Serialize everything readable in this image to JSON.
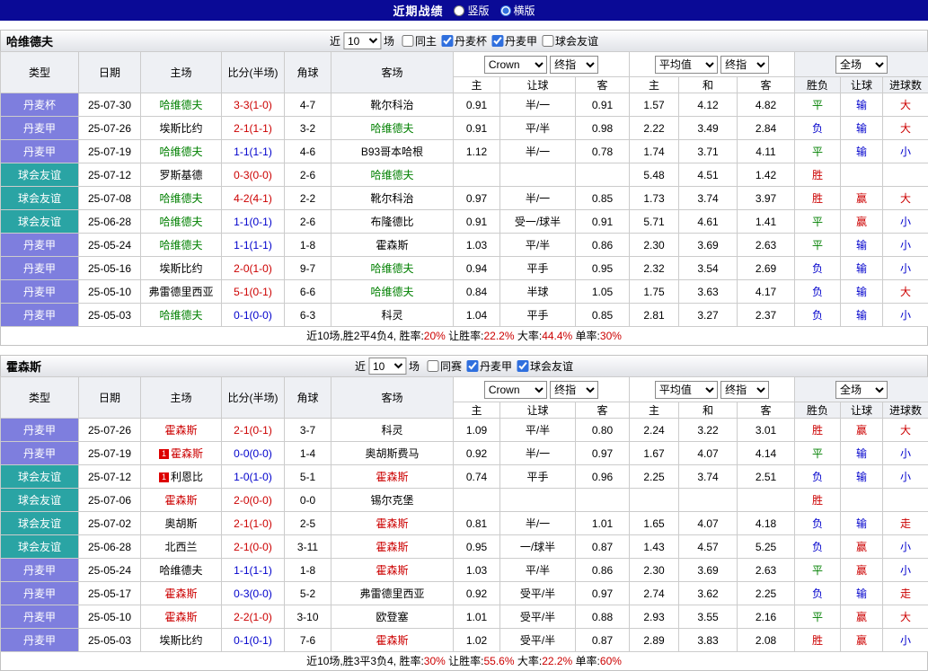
{
  "titlebar": {
    "title": "近期战绩",
    "radios": [
      {
        "label": "竖版",
        "selected": false
      },
      {
        "label": "横版",
        "selected": true
      }
    ]
  },
  "colors": {
    "r": "#cc0000",
    "b": "#0000cc",
    "g": "#008000",
    "k": "#000000",
    "p": "#7e7ede",
    "t": "#2aa4a4"
  },
  "filter_labels": {
    "near": "近",
    "games": "场"
  },
  "dropdowns": {
    "company": "Crown",
    "company_mode": "终指",
    "average": "平均值",
    "average_mode": "终指",
    "scope": "全场"
  },
  "columns": {
    "type": "类型",
    "date": "日期",
    "home": "主场",
    "score": "比分(半场)",
    "corners": "角球",
    "away": "客场",
    "sub": [
      "主",
      "让球",
      "客",
      "主",
      "和",
      "客",
      "胜负",
      "让球",
      "进球数"
    ]
  },
  "sections": [
    {
      "team": "哈维德夫",
      "subject_color": "#008000",
      "filter": {
        "count": "10",
        "checkboxes": [
          {
            "label": "同主",
            "checked": false
          },
          {
            "label": "丹麦杯",
            "checked": true
          },
          {
            "label": "丹麦甲",
            "checked": true
          },
          {
            "label": "球会友谊",
            "checked": false
          }
        ]
      },
      "rows": [
        {
          "type": "丹麦杯",
          "tc": "p",
          "date": "25-07-30",
          "home": "哈维德夫",
          "hs": true,
          "hb": "",
          "score": "3-3(1-0)",
          "sc": "r",
          "corners": "4-7",
          "away": "靴尔科治",
          "as": false,
          "ab": "",
          "odds": [
            "0.91",
            "半/一",
            "0.91"
          ],
          "avg": [
            "1.57",
            "4.12",
            "4.82"
          ],
          "res": "平",
          "resc": "g",
          "hc": "输",
          "hcc": "b",
          "goal": "大",
          "gc": "r"
        },
        {
          "type": "丹麦甲",
          "tc": "p",
          "date": "25-07-26",
          "home": "埃斯比约",
          "hs": false,
          "hb": "",
          "score": "2-1(1-1)",
          "sc": "r",
          "corners": "3-2",
          "away": "哈维德夫",
          "as": true,
          "ab": "",
          "odds": [
            "0.91",
            "平/半",
            "0.98"
          ],
          "avg": [
            "2.22",
            "3.49",
            "2.84"
          ],
          "res": "负",
          "resc": "b",
          "hc": "输",
          "hcc": "b",
          "goal": "大",
          "gc": "r"
        },
        {
          "type": "丹麦甲",
          "tc": "p",
          "date": "25-07-19",
          "home": "哈维德夫",
          "hs": true,
          "hb": "",
          "score": "1-1(1-1)",
          "sc": "b",
          "corners": "4-6",
          "away": "B93哥本哈根",
          "as": false,
          "ab": "",
          "odds": [
            "1.12",
            "半/一",
            "0.78"
          ],
          "avg": [
            "1.74",
            "3.71",
            "4.11"
          ],
          "res": "平",
          "resc": "g",
          "hc": "输",
          "hcc": "b",
          "goal": "小",
          "gc": "b"
        },
        {
          "type": "球会友谊",
          "tc": "t",
          "date": "25-07-12",
          "home": "罗斯基德",
          "hs": false,
          "hb": "",
          "score": "0-3(0-0)",
          "sc": "r",
          "corners": "2-6",
          "away": "哈维德夫",
          "as": true,
          "ab": "",
          "odds": [
            "",
            "",
            ""
          ],
          "avg": [
            "5.48",
            "4.51",
            "1.42"
          ],
          "res": "胜",
          "resc": "r",
          "hc": "",
          "hcc": "k",
          "goal": "",
          "gc": "k"
        },
        {
          "type": "球会友谊",
          "tc": "t",
          "date": "25-07-08",
          "home": "哈维德夫",
          "hs": true,
          "hb": "",
          "score": "4-2(4-1)",
          "sc": "r",
          "corners": "2-2",
          "away": "靴尔科治",
          "as": false,
          "ab": "",
          "odds": [
            "0.97",
            "半/一",
            "0.85"
          ],
          "avg": [
            "1.73",
            "3.74",
            "3.97"
          ],
          "res": "胜",
          "resc": "r",
          "hc": "赢",
          "hcc": "r",
          "goal": "大",
          "gc": "r"
        },
        {
          "type": "球会友谊",
          "tc": "t",
          "date": "25-06-28",
          "home": "哈维德夫",
          "hs": true,
          "hb": "",
          "score": "1-1(0-1)",
          "sc": "b",
          "corners": "2-6",
          "away": "布隆德比",
          "as": false,
          "ab": "",
          "odds": [
            "0.91",
            "受一/球半",
            "0.91"
          ],
          "avg": [
            "5.71",
            "4.61",
            "1.41"
          ],
          "res": "平",
          "resc": "g",
          "hc": "赢",
          "hcc": "r",
          "goal": "小",
          "gc": "b"
        },
        {
          "type": "丹麦甲",
          "tc": "p",
          "date": "25-05-24",
          "home": "哈维德夫",
          "hs": true,
          "hb": "",
          "score": "1-1(1-1)",
          "sc": "b",
          "corners": "1-8",
          "away": "霍森斯",
          "as": false,
          "ab": "",
          "odds": [
            "1.03",
            "平/半",
            "0.86"
          ],
          "avg": [
            "2.30",
            "3.69",
            "2.63"
          ],
          "res": "平",
          "resc": "g",
          "hc": "输",
          "hcc": "b",
          "goal": "小",
          "gc": "b"
        },
        {
          "type": "丹麦甲",
          "tc": "p",
          "date": "25-05-16",
          "home": "埃斯比约",
          "hs": false,
          "hb": "",
          "score": "2-0(1-0)",
          "sc": "r",
          "corners": "9-7",
          "away": "哈维德夫",
          "as": true,
          "ab": "",
          "odds": [
            "0.94",
            "平手",
            "0.95"
          ],
          "avg": [
            "2.32",
            "3.54",
            "2.69"
          ],
          "res": "负",
          "resc": "b",
          "hc": "输",
          "hcc": "b",
          "goal": "小",
          "gc": "b"
        },
        {
          "type": "丹麦甲",
          "tc": "p",
          "date": "25-05-10",
          "home": "弗雷德里西亚",
          "hs": false,
          "hb": "",
          "score": "5-1(0-1)",
          "sc": "r",
          "corners": "6-6",
          "away": "哈维德夫",
          "as": true,
          "ab": "",
          "odds": [
            "0.84",
            "半球",
            "1.05"
          ],
          "avg": [
            "1.75",
            "3.63",
            "4.17"
          ],
          "res": "负",
          "resc": "b",
          "hc": "输",
          "hcc": "b",
          "goal": "大",
          "gc": "r"
        },
        {
          "type": "丹麦甲",
          "tc": "p",
          "date": "25-05-03",
          "home": "哈维德夫",
          "hs": true,
          "hb": "",
          "score": "0-1(0-0)",
          "sc": "b",
          "corners": "6-3",
          "away": "科灵",
          "as": false,
          "ab": "",
          "odds": [
            "1.04",
            "平手",
            "0.85"
          ],
          "avg": [
            "2.81",
            "3.27",
            "2.37"
          ],
          "res": "负",
          "resc": "b",
          "hc": "输",
          "hcc": "b",
          "goal": "小",
          "gc": "b"
        }
      ],
      "summary": {
        "prefix": "近10场,胜2平4负4,",
        "stats": [
          {
            "label": "胜率:",
            "value": "20%"
          },
          {
            "label": "让胜率:",
            "value": "22.2%"
          },
          {
            "label": "大率:",
            "value": "44.4%"
          },
          {
            "label": "单率:",
            "value": "30%"
          }
        ]
      }
    },
    {
      "team": "霍森斯",
      "subject_color": "#cc0000",
      "filter": {
        "count": "10",
        "checkboxes": [
          {
            "label": "同赛",
            "checked": false
          },
          {
            "label": "丹麦甲",
            "checked": true
          },
          {
            "label": "球会友谊",
            "checked": true
          }
        ]
      },
      "rows": [
        {
          "type": "丹麦甲",
          "tc": "p",
          "date": "25-07-26",
          "home": "霍森斯",
          "hs": true,
          "hb": "",
          "score": "2-1(0-1)",
          "sc": "r",
          "corners": "3-7",
          "away": "科灵",
          "as": false,
          "ab": "",
          "odds": [
            "1.09",
            "平/半",
            "0.80"
          ],
          "avg": [
            "2.24",
            "3.22",
            "3.01"
          ],
          "res": "胜",
          "resc": "r",
          "hc": "赢",
          "hcc": "r",
          "goal": "大",
          "gc": "r"
        },
        {
          "type": "丹麦甲",
          "tc": "p",
          "date": "25-07-19",
          "home": "霍森斯",
          "hs": true,
          "hb": "1",
          "score": "0-0(0-0)",
          "sc": "b",
          "corners": "1-4",
          "away": "奥胡斯费马",
          "as": false,
          "ab": "",
          "odds": [
            "0.92",
            "半/一",
            "0.97"
          ],
          "avg": [
            "1.67",
            "4.07",
            "4.14"
          ],
          "res": "平",
          "resc": "g",
          "hc": "输",
          "hcc": "b",
          "goal": "小",
          "gc": "b"
        },
        {
          "type": "球会友谊",
          "tc": "t",
          "date": "25-07-12",
          "home": "利恩比",
          "hs": false,
          "hb": "1",
          "score": "1-0(1-0)",
          "sc": "b",
          "corners": "5-1",
          "away": "霍森斯",
          "as": true,
          "ab": "",
          "odds": [
            "0.74",
            "平手",
            "0.96"
          ],
          "avg": [
            "2.25",
            "3.74",
            "2.51"
          ],
          "res": "负",
          "resc": "b",
          "hc": "输",
          "hcc": "b",
          "goal": "小",
          "gc": "b"
        },
        {
          "type": "球会友谊",
          "tc": "t",
          "date": "25-07-06",
          "home": "霍森斯",
          "hs": true,
          "hb": "",
          "score": "2-0(0-0)",
          "sc": "r",
          "corners": "0-0",
          "away": "锡尔克堡",
          "as": false,
          "ab": "",
          "odds": [
            "",
            "",
            ""
          ],
          "avg": [
            "",
            "",
            ""
          ],
          "res": "胜",
          "resc": "r",
          "hc": "",
          "hcc": "k",
          "goal": "",
          "gc": "k"
        },
        {
          "type": "球会友谊",
          "tc": "t",
          "date": "25-07-02",
          "home": "奥胡斯",
          "hs": false,
          "hb": "",
          "score": "2-1(1-0)",
          "sc": "r",
          "corners": "2-5",
          "away": "霍森斯",
          "as": true,
          "ab": "",
          "odds": [
            "0.81",
            "半/一",
            "1.01"
          ],
          "avg": [
            "1.65",
            "4.07",
            "4.18"
          ],
          "res": "负",
          "resc": "b",
          "hc": "输",
          "hcc": "b",
          "goal": "走",
          "gc": "r"
        },
        {
          "type": "球会友谊",
          "tc": "t",
          "date": "25-06-28",
          "home": "北西兰",
          "hs": false,
          "hb": "",
          "score": "2-1(0-0)",
          "sc": "r",
          "corners": "3-11",
          "away": "霍森斯",
          "as": true,
          "ab": "",
          "odds": [
            "0.95",
            "一/球半",
            "0.87"
          ],
          "avg": [
            "1.43",
            "4.57",
            "5.25"
          ],
          "res": "负",
          "resc": "b",
          "hc": "赢",
          "hcc": "r",
          "goal": "小",
          "gc": "b"
        },
        {
          "type": "丹麦甲",
          "tc": "p",
          "date": "25-05-24",
          "home": "哈维德夫",
          "hs": false,
          "hb": "",
          "score": "1-1(1-1)",
          "sc": "b",
          "corners": "1-8",
          "away": "霍森斯",
          "as": true,
          "ab": "",
          "odds": [
            "1.03",
            "平/半",
            "0.86"
          ],
          "avg": [
            "2.30",
            "3.69",
            "2.63"
          ],
          "res": "平",
          "resc": "g",
          "hc": "赢",
          "hcc": "r",
          "goal": "小",
          "gc": "b"
        },
        {
          "type": "丹麦甲",
          "tc": "p",
          "date": "25-05-17",
          "home": "霍森斯",
          "hs": true,
          "hb": "",
          "score": "0-3(0-0)",
          "sc": "b",
          "corners": "5-2",
          "away": "弗雷德里西亚",
          "as": false,
          "ab": "",
          "odds": [
            "0.92",
            "受平/半",
            "0.97"
          ],
          "avg": [
            "2.74",
            "3.62",
            "2.25"
          ],
          "res": "负",
          "resc": "b",
          "hc": "输",
          "hcc": "b",
          "goal": "走",
          "gc": "r"
        },
        {
          "type": "丹麦甲",
          "tc": "p",
          "date": "25-05-10",
          "home": "霍森斯",
          "hs": true,
          "hb": "",
          "score": "2-2(1-0)",
          "sc": "r",
          "corners": "3-10",
          "away": "欧登塞",
          "as": false,
          "ab": "",
          "odds": [
            "1.01",
            "受平/半",
            "0.88"
          ],
          "avg": [
            "2.93",
            "3.55",
            "2.16"
          ],
          "res": "平",
          "resc": "g",
          "hc": "赢",
          "hcc": "r",
          "goal": "大",
          "gc": "r"
        },
        {
          "type": "丹麦甲",
          "tc": "p",
          "date": "25-05-03",
          "home": "埃斯比约",
          "hs": false,
          "hb": "",
          "score": "0-1(0-1)",
          "sc": "b",
          "corners": "7-6",
          "away": "霍森斯",
          "as": true,
          "ab": "",
          "odds": [
            "1.02",
            "受平/半",
            "0.87"
          ],
          "avg": [
            "2.89",
            "3.83",
            "2.08"
          ],
          "res": "胜",
          "resc": "r",
          "hc": "赢",
          "hcc": "r",
          "goal": "小",
          "gc": "b"
        }
      ],
      "summary": {
        "prefix": "近10场,胜3平3负4,",
        "stats": [
          {
            "label": "胜率:",
            "value": "30%"
          },
          {
            "label": "让胜率:",
            "value": "55.6%"
          },
          {
            "label": "大率:",
            "value": "22.2%"
          },
          {
            "label": "单率:",
            "value": "60%"
          }
        ]
      }
    }
  ]
}
